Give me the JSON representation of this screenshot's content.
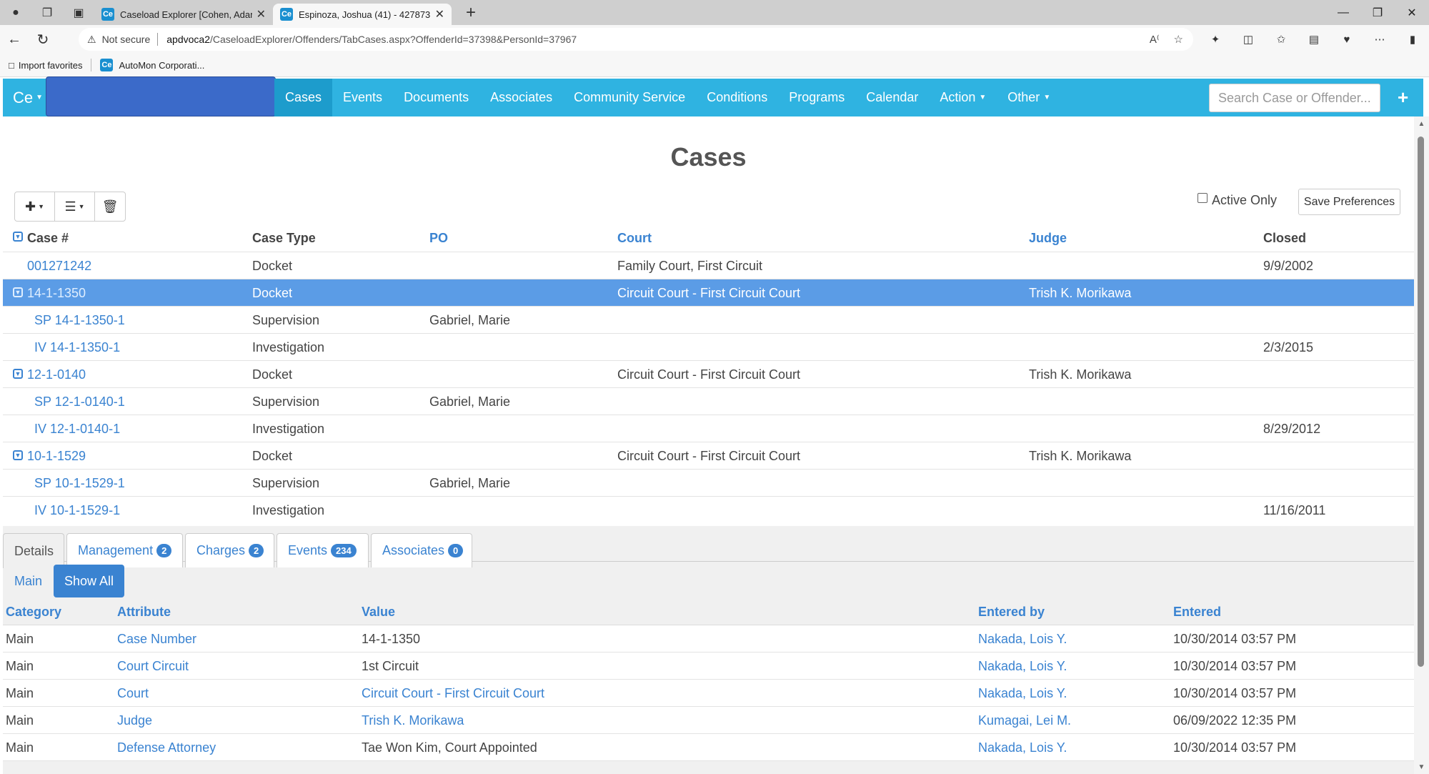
{
  "browser": {
    "tabs": [
      {
        "label": "Caseload Explorer [Cohen, Adam",
        "active": false
      },
      {
        "label": "Espinoza, Joshua (41) - 427873",
        "active": true
      }
    ],
    "favicon_text": "Ce",
    "url_warning": "Not secure",
    "url_host": "apdvoca2",
    "url_path": "/CaseloadExplorer/Offenders/TabCases.aspx?OffenderId=37398&PersonId=37967",
    "favorites": [
      {
        "label": "Import favorites"
      },
      {
        "label": "AutoMon Corporati..."
      }
    ]
  },
  "app": {
    "brand": "Ce",
    "nav": [
      {
        "label": "Cases",
        "active": true,
        "dropdown": false
      },
      {
        "label": "Events",
        "active": false,
        "dropdown": false
      },
      {
        "label": "Documents",
        "active": false,
        "dropdown": false
      },
      {
        "label": "Associates",
        "active": false,
        "dropdown": false
      },
      {
        "label": "Community Service",
        "active": false,
        "dropdown": false
      },
      {
        "label": "Conditions",
        "active": false,
        "dropdown": false
      },
      {
        "label": "Programs",
        "active": false,
        "dropdown": false
      },
      {
        "label": "Calendar",
        "active": false,
        "dropdown": false
      },
      {
        "label": "Action",
        "active": false,
        "dropdown": true
      },
      {
        "label": "Other",
        "active": false,
        "dropdown": true
      }
    ],
    "search_placeholder": "Search Case or Offender...",
    "accent": "#2fb3e1",
    "link_color": "#3a83d1",
    "selected_row_color": "#5b9ce6"
  },
  "page": {
    "title": "Cases",
    "active_only_label": "Active Only",
    "save_preferences_label": "Save Preferences"
  },
  "cases": {
    "columns": [
      "Case #",
      "Case Type",
      "PO",
      "Court",
      "Judge",
      "Closed"
    ],
    "rows": [
      {
        "case": "001271242",
        "type": "Docket",
        "po": "",
        "court": "Family Court, First Circuit",
        "judge": "",
        "closed": "9/9/2002",
        "expandable": false,
        "child": false,
        "selected": false
      },
      {
        "case": "14-1-1350",
        "type": "Docket",
        "po": "",
        "court": "Circuit Court - First Circuit Court",
        "judge": "Trish K. Morikawa",
        "closed": "",
        "expandable": true,
        "child": false,
        "selected": true
      },
      {
        "case": "SP 14-1-1350-1",
        "type": "Supervision",
        "po": "Gabriel, Marie",
        "court": "",
        "judge": "",
        "closed": "",
        "expandable": false,
        "child": true,
        "selected": false
      },
      {
        "case": "IV 14-1-1350-1",
        "type": "Investigation",
        "po": "",
        "court": "",
        "judge": "",
        "closed": "2/3/2015",
        "expandable": false,
        "child": true,
        "selected": false
      },
      {
        "case": "12-1-0140",
        "type": "Docket",
        "po": "",
        "court": "Circuit Court - First Circuit Court",
        "judge": "Trish K. Morikawa",
        "closed": "",
        "expandable": true,
        "child": false,
        "selected": false
      },
      {
        "case": "SP 12-1-0140-1",
        "type": "Supervision",
        "po": "Gabriel, Marie",
        "court": "",
        "judge": "",
        "closed": "",
        "expandable": false,
        "child": true,
        "selected": false
      },
      {
        "case": "IV 12-1-0140-1",
        "type": "Investigation",
        "po": "",
        "court": "",
        "judge": "",
        "closed": "8/29/2012",
        "expandable": false,
        "child": true,
        "selected": false
      },
      {
        "case": "10-1-1529",
        "type": "Docket",
        "po": "",
        "court": "Circuit Court - First Circuit Court",
        "judge": "Trish K. Morikawa",
        "closed": "",
        "expandable": true,
        "child": false,
        "selected": false
      },
      {
        "case": "SP 10-1-1529-1",
        "type": "Supervision",
        "po": "Gabriel, Marie",
        "court": "",
        "judge": "",
        "closed": "",
        "expandable": false,
        "child": true,
        "selected": false
      },
      {
        "case": "IV 10-1-1529-1",
        "type": "Investigation",
        "po": "",
        "court": "",
        "judge": "",
        "closed": "11/16/2011",
        "expandable": false,
        "child": true,
        "selected": false
      }
    ]
  },
  "details": {
    "tabs": [
      {
        "label": "Details",
        "badge": null,
        "active": true
      },
      {
        "label": "Management",
        "badge": "2",
        "active": false
      },
      {
        "label": "Charges",
        "badge": "2",
        "active": false
      },
      {
        "label": "Events",
        "badge": "234",
        "active": false
      },
      {
        "label": "Associates",
        "badge": "0",
        "active": false
      }
    ],
    "filters": {
      "main": "Main",
      "show_all": "Show All"
    },
    "columns": [
      "Category",
      "Attribute",
      "Value",
      "Entered by",
      "Entered"
    ],
    "rows": [
      {
        "category": "Main",
        "attribute": "Case Number",
        "value": "14-1-1350",
        "value_link": false,
        "entered_by": "Nakada, Lois Y.",
        "entered": "10/30/2014 03:57 PM"
      },
      {
        "category": "Main",
        "attribute": "Court Circuit",
        "value": "1st Circuit",
        "value_link": false,
        "entered_by": "Nakada, Lois Y.",
        "entered": "10/30/2014 03:57 PM"
      },
      {
        "category": "Main",
        "attribute": "Court",
        "value": "Circuit Court - First Circuit Court",
        "value_link": true,
        "entered_by": "Nakada, Lois Y.",
        "entered": "10/30/2014 03:57 PM"
      },
      {
        "category": "Main",
        "attribute": "Judge",
        "value": "Trish K. Morikawa",
        "value_link": true,
        "entered_by": "Kumagai, Lei M.",
        "entered": "06/09/2022 12:35 PM"
      },
      {
        "category": "Main",
        "attribute": "Defense Attorney",
        "value": "Tae Won Kim, Court Appointed",
        "value_link": false,
        "entered_by": "Nakada, Lois Y.",
        "entered": "10/30/2014 03:57 PM"
      }
    ]
  }
}
